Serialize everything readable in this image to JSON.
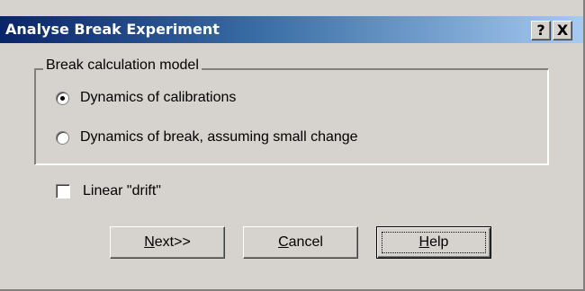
{
  "window": {
    "title": "Analyse Break Experiment",
    "help_glyph": "?",
    "close_glyph": "X"
  },
  "group": {
    "label": "Break calculation model",
    "options": [
      {
        "label": "Dynamics of calibrations",
        "selected": true
      },
      {
        "label": "Dynamics of break, assuming small change",
        "selected": false
      }
    ]
  },
  "checkbox": {
    "label": "Linear \"drift\"",
    "checked": false
  },
  "buttons": {
    "next": {
      "mnemonic": "N",
      "rest": "ext>>"
    },
    "cancel": {
      "mnemonic": "C",
      "rest": "ancel"
    },
    "help": {
      "mnemonic": "H",
      "rest": "elp"
    }
  }
}
